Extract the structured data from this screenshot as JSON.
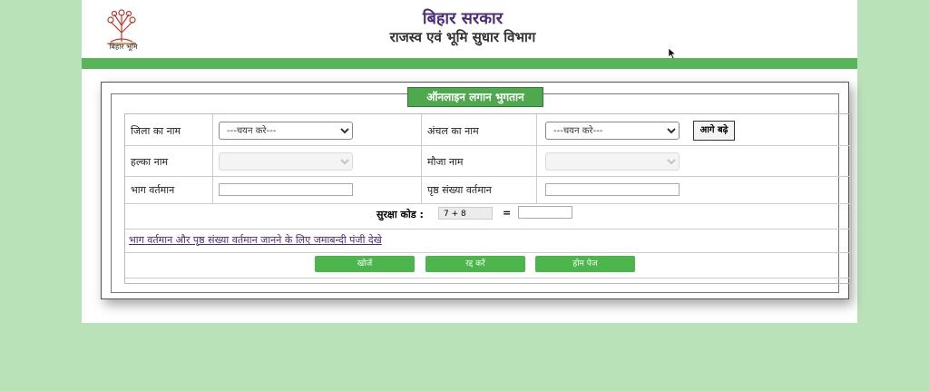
{
  "header": {
    "title_line1": "बिहार सरकार",
    "title_line2": "राजस्व एवं भूमि सुधार विभाग",
    "logo_text": "बिहार भूमि"
  },
  "form": {
    "legend": "ऑनलाइन लगान भुगतान",
    "district_label": "जिला का नाम",
    "district_value": "---चयन करे---",
    "circle_label": "अंचल का नाम",
    "circle_value": "---चयन करे---",
    "next_button": "आगे बढ़े",
    "halka_label": "हल्का नाम",
    "mauja_label": "मौजा नाम",
    "bhag_label": "भाग वर्तमान",
    "page_label": "पृष्ठ संख्या वर्तमान",
    "captcha_label": "सुरक्षा कोड :",
    "captcha_code": "7 + 8",
    "equals": "=",
    "jamabandi_link": "भाग वर्तमान और पृष्ठ संख्या वर्तमान जानने के लिए जमाबन्दी पंजी देखे",
    "search_button": "खोजें",
    "cancel_button": "रद्द करें",
    "home_button": "होम पेज"
  },
  "colors": {
    "background": "#b9e2b9",
    "strip": "#5ab55a",
    "button": "#4cb54c",
    "title": "#4b2c7a"
  }
}
